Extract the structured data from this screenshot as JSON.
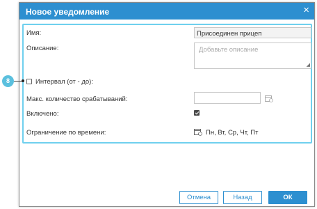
{
  "dialog": {
    "title": "Новое уведомление",
    "close_glyph": "×"
  },
  "form": {
    "name_label": "Имя:",
    "name_value": "Присоединен прицеп",
    "description_label": "Описание:",
    "description_placeholder": "Добавьте описание",
    "interval_label": "Интервал (от - до):",
    "interval_checked": false,
    "max_triggers_label": "Макс. количество срабатываний:",
    "max_triggers_value": "",
    "enabled_label": "Включено:",
    "enabled_checked": true,
    "time_limit_label": "Ограничение по времени:",
    "time_limit_value": "Пн, Вт, Ср, Чт, Пт"
  },
  "callout": {
    "number": "8"
  },
  "buttons": {
    "cancel": "Отмена",
    "back": "Назад",
    "ok": "ОК"
  },
  "colors": {
    "accent": "#2d8fd0",
    "highlight": "#6fd0ee",
    "badge": "#5bc0de"
  },
  "icons": [
    "close-icon",
    "calendar-icon",
    "checkbox-icon",
    "resize-handle-icon"
  ]
}
